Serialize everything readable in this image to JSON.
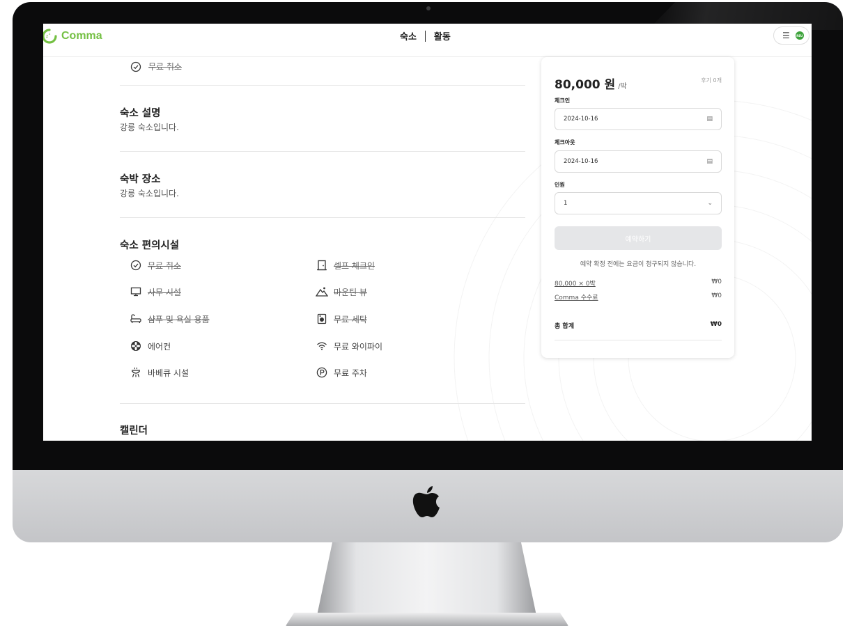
{
  "app": {
    "brand": "Comma",
    "brand_color": "#74c043"
  },
  "nav": {
    "stay": "숙소",
    "activity": "활동"
  },
  "header_menu": {
    "menu_icon": "hamburger-icon",
    "avatar_text": "REU"
  },
  "listing": {
    "top_item": {
      "icon": "check-circle-icon",
      "label": "무료 취소",
      "strikethrough": true
    },
    "description": {
      "title": "숙소 설명",
      "text": "강릉 숙소입니다."
    },
    "location": {
      "title": "숙박 장소",
      "text": "강릉 숙소입니다."
    },
    "amenities": {
      "title": "숙소 편의시설",
      "items": [
        {
          "label": "무료 취소",
          "icon": "check-circle-icon",
          "strikethrough": true
        },
        {
          "label": "셀프 체크인",
          "icon": "door-icon",
          "strikethrough": true
        },
        {
          "label": "사무 시설",
          "icon": "monitor-icon",
          "strikethrough": true
        },
        {
          "label": "마운틴 뷰",
          "icon": "mountain-icon",
          "strikethrough": true
        },
        {
          "label": "샴푸 및 욕실 용품",
          "icon": "bathtub-icon",
          "strikethrough": true
        },
        {
          "label": "무료 세탁",
          "icon": "washer-icon",
          "strikethrough": true
        },
        {
          "label": "에어컨",
          "icon": "fan-icon",
          "strikethrough": false
        },
        {
          "label": "무료 와이파이",
          "icon": "wifi-icon",
          "strikethrough": false
        },
        {
          "label": "바베큐 시설",
          "icon": "grill-icon",
          "strikethrough": false
        },
        {
          "label": "무료 주차",
          "icon": "parking-icon",
          "strikethrough": false
        }
      ]
    },
    "calendar": {
      "title": "캘린더"
    }
  },
  "booking": {
    "price": "80,000 원",
    "per_night": "/박",
    "reviews": "후기 0개",
    "checkin_label": "체크인",
    "checkin_value": "2024-10-16",
    "checkout_label": "체크아웃",
    "checkout_value": "2024-10-16",
    "guests_label": "인원",
    "guests_value": "1",
    "reserve_button": "예약하기",
    "note": "예약 확정 전에는 요금이 청구되지 않습니다.",
    "nights_line": {
      "label": "80,000 × 0박",
      "value": "₩0"
    },
    "fee_line": {
      "label": "Comma 수수료",
      "value": "₩0"
    },
    "total": {
      "label": "총 합계",
      "value": "₩0"
    }
  }
}
